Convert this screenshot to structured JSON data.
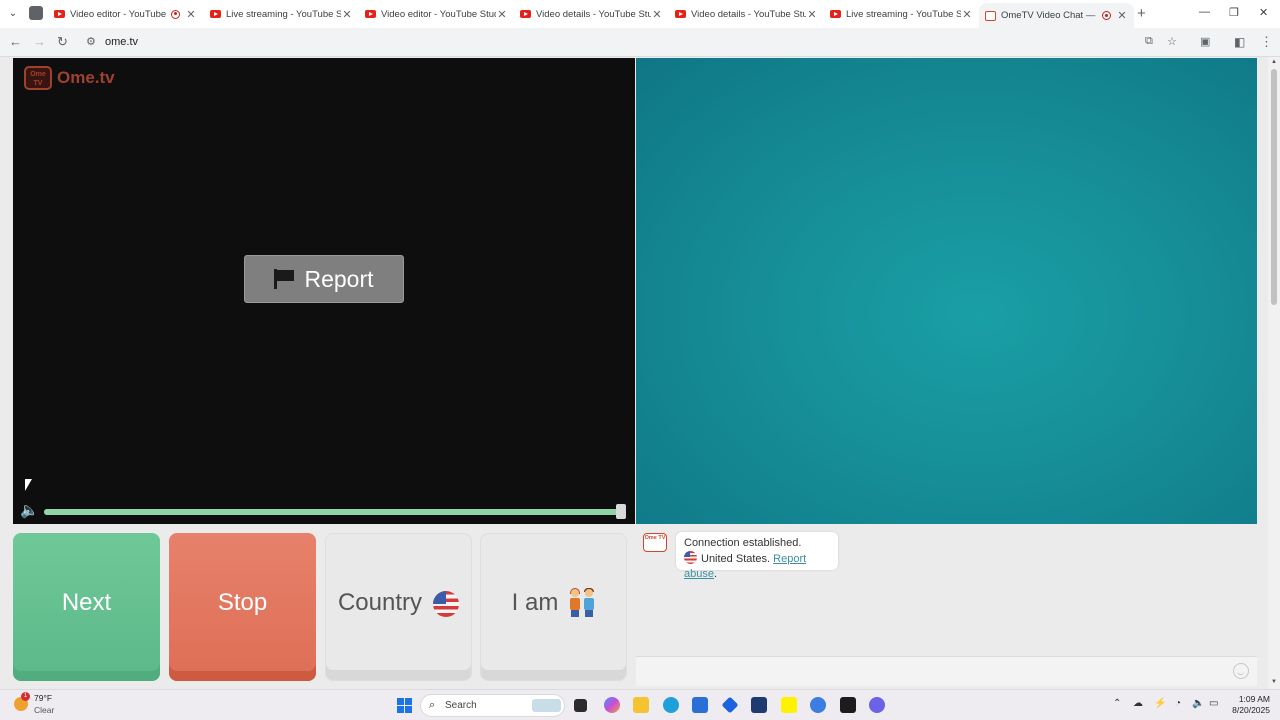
{
  "browser": {
    "tabs": [
      {
        "title": "Video editor - YouTube Studio",
        "recording": true,
        "active": false
      },
      {
        "title": "Live streaming - YouTube Studio",
        "recording": false,
        "active": false
      },
      {
        "title": "Video editor - YouTube Studio",
        "recording": false,
        "active": false
      },
      {
        "title": "Video details - YouTube Studio",
        "recording": false,
        "active": false
      },
      {
        "title": "Video details - YouTube Studio",
        "recording": false,
        "active": false
      },
      {
        "title": "Live streaming - YouTube Studio",
        "recording": false,
        "active": false
      },
      {
        "title": "OmeTV Video Chat — Omegle",
        "recording": true,
        "active": true
      }
    ],
    "url": "ome.tv"
  },
  "page": {
    "logo_text": "Ome.tv",
    "logo_badge": "Ome TV",
    "report_button": "Report",
    "volume_level": 1.0,
    "buttons": {
      "next": "Next",
      "stop": "Stop",
      "country": "Country",
      "iam": "I am"
    },
    "chat": {
      "message": "Connection established.",
      "country": "United States.",
      "report_link": "Report abuse",
      "report_suffix": "."
    },
    "colors": {
      "next": "#6fc898",
      "stop": "#e7816b",
      "accent_teal": "#168e98"
    }
  },
  "taskbar": {
    "weather_temp": "79°F",
    "weather_cond": "Clear",
    "weather_badge": "1",
    "search_placeholder": "Search",
    "time": "1:09 AM",
    "date": "8/20/2025"
  }
}
